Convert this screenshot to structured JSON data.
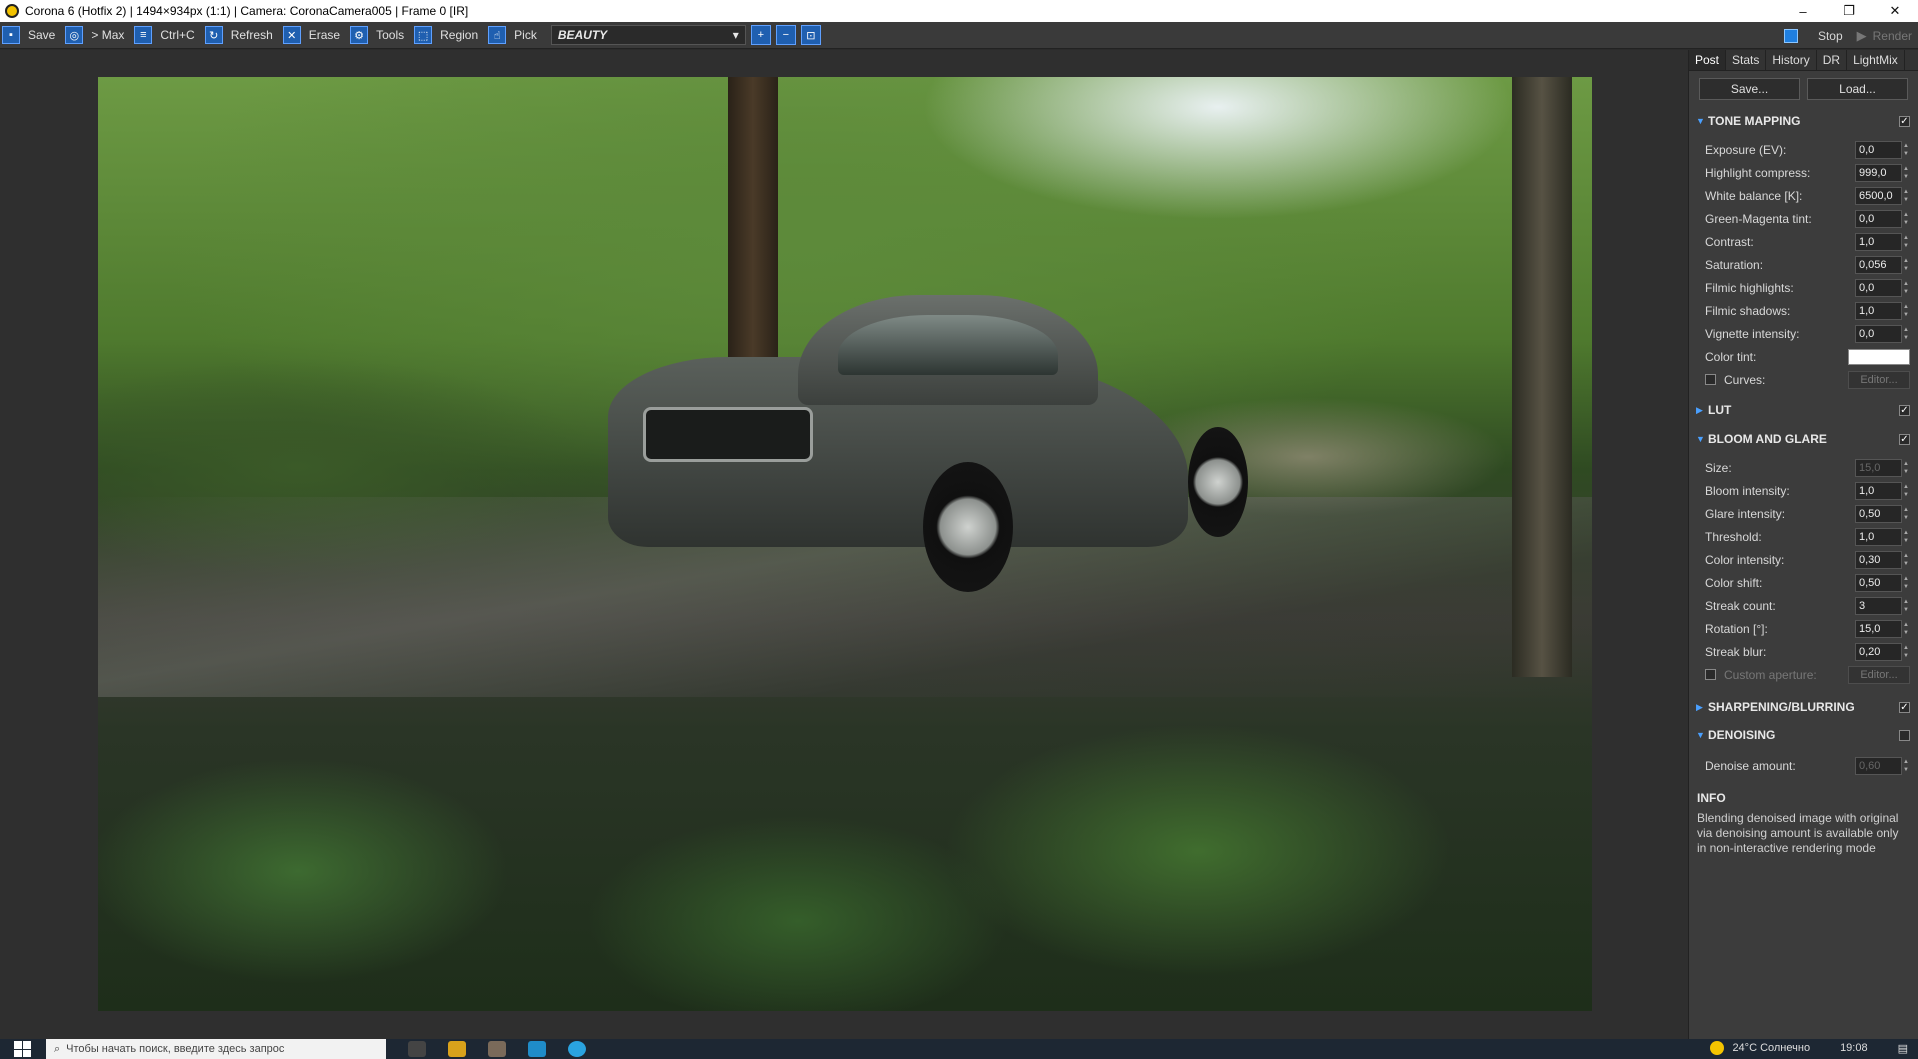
{
  "window": {
    "title": "Corona 6 (Hotfix 2) | 1494×934px (1:1) | Camera: CoronaCamera005 | Frame 0 [IR]",
    "controls": [
      "–",
      "❐",
      "✕"
    ]
  },
  "toolbar": {
    "save": "Save",
    "to_max": "> Max",
    "copy": "Ctrl+C",
    "refresh": "Refresh",
    "erase": "Erase",
    "tools": "Tools",
    "region": "Region",
    "pick": "Pick",
    "render_pass": "BEAUTY",
    "stop": "Stop",
    "render": "Render"
  },
  "panel": {
    "tabs": [
      "Post",
      "Stats",
      "History",
      "DR",
      "LightMix"
    ],
    "save": "Save...",
    "load": "Load...",
    "tone_mapping": {
      "title": "TONE MAPPING",
      "enabled": true,
      "rows": [
        {
          "label": "Exposure (EV):",
          "value": "0,0"
        },
        {
          "label": "Highlight compress:",
          "value": "999,0"
        },
        {
          "label": "White balance [K]:",
          "value": "6500,0"
        },
        {
          "label": "Green-Magenta tint:",
          "value": "0,0"
        },
        {
          "label": "Contrast:",
          "value": "1,0"
        },
        {
          "label": "Saturation:",
          "value": "0,056"
        },
        {
          "label": "Filmic highlights:",
          "value": "0,0"
        },
        {
          "label": "Filmic shadows:",
          "value": "1,0"
        },
        {
          "label": "Vignette intensity:",
          "value": "0,0"
        }
      ],
      "color_tint": "Color tint:",
      "color_tint_value": "#ffffff",
      "curves": "Curves:",
      "editor": "Editor..."
    },
    "lut": {
      "title": "LUT",
      "enabled": true
    },
    "bloom": {
      "title": "BLOOM AND GLARE",
      "enabled": true,
      "rows": [
        {
          "label": "Size:",
          "value": "15,0"
        },
        {
          "label": "Bloom intensity:",
          "value": "1,0"
        },
        {
          "label": "Glare intensity:",
          "value": "0,50"
        },
        {
          "label": "Threshold:",
          "value": "1,0"
        },
        {
          "label": "Color intensity:",
          "value": "0,30"
        },
        {
          "label": "Color shift:",
          "value": "0,50"
        },
        {
          "label": "Streak count:",
          "value": "3"
        },
        {
          "label": "Rotation [°]:",
          "value": "15,0"
        },
        {
          "label": "Streak blur:",
          "value": "0,20"
        }
      ],
      "custom_aperture": "Custom aperture:",
      "editor": "Editor..."
    },
    "sharpening": {
      "title": "SHARPENING/BLURRING",
      "enabled": true
    },
    "denoising": {
      "title": "DENOISING",
      "enabled": false,
      "amount_label": "Denoise amount:",
      "amount_value": "0,60"
    },
    "info": {
      "title": "INFO",
      "text": "Blending denoised image with original via denoising amount is available only in non-interactive rendering mode"
    }
  },
  "taskbar": {
    "search_placeholder": "Чтобы начать поиск, введите здесь запрос",
    "weather": "24°C Солнечно",
    "time": "19:08"
  }
}
